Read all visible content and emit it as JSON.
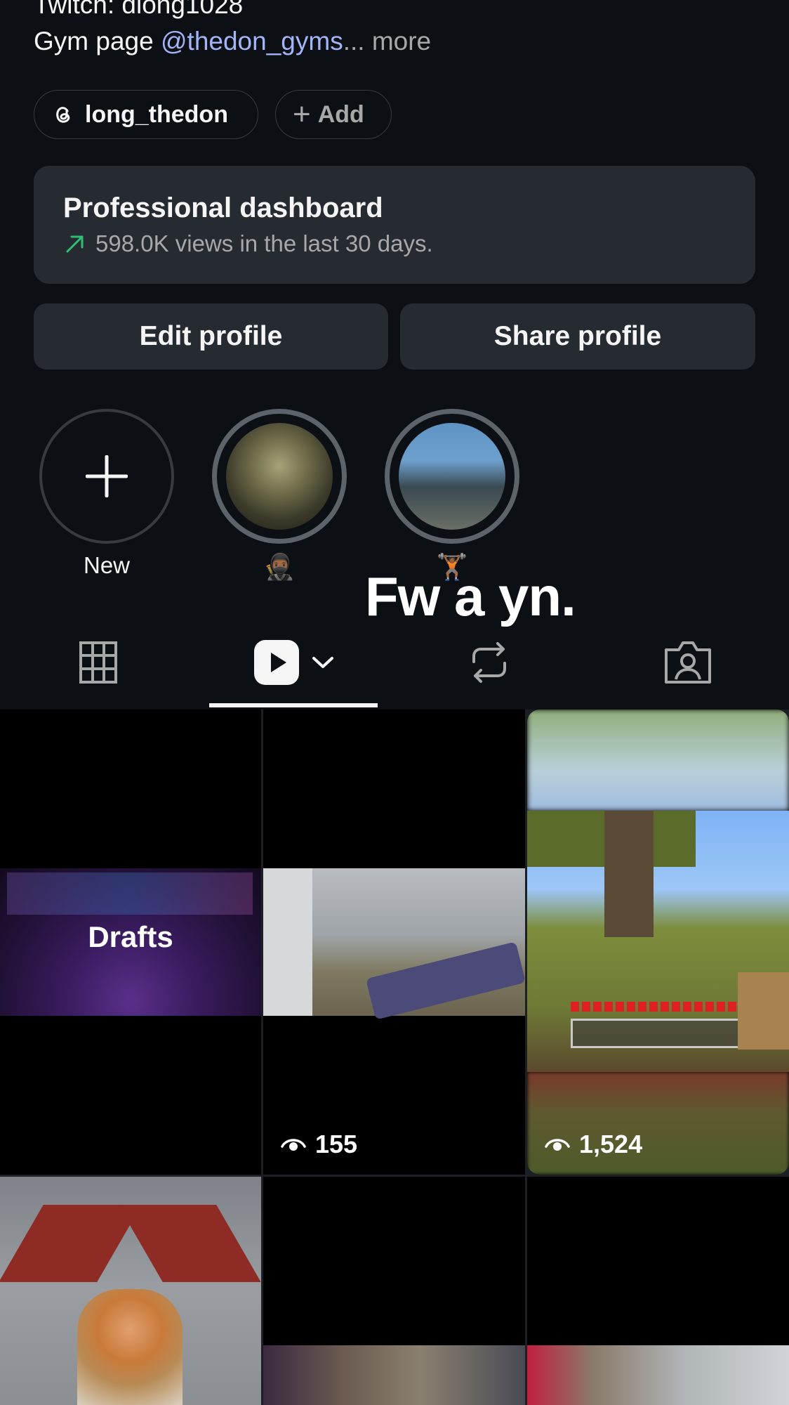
{
  "bio": {
    "twitch_line": "Twitch: dlong1028",
    "gym_prefix": "Gym page ",
    "gym_link": "@thedon_gyms",
    "ellipsis": "...",
    "more": " more"
  },
  "links": {
    "threads_handle": "long_thedon",
    "add_label": "Add"
  },
  "dashboard": {
    "title": "Professional dashboard",
    "subtitle": "598.0K views in the last 30 days.",
    "accent": "#2fbf71"
  },
  "buttons": {
    "edit": "Edit profile",
    "share": "Share profile"
  },
  "highlights": [
    {
      "label": "New",
      "kind": "new"
    },
    {
      "label": "🥷🏾",
      "kind": "image"
    },
    {
      "label": "🏋🏾",
      "kind": "image"
    }
  ],
  "overlay_caption": "Fw a yn.",
  "tabs": {
    "active": "reels",
    "icons": [
      "grid-icon",
      "reels-icon",
      "reposts-icon",
      "tagged-icon"
    ]
  },
  "grid": {
    "drafts_label": "Drafts",
    "item2_views": "155",
    "item3_views": "1,524"
  },
  "colors": {
    "background": "#0c1014",
    "surface": "#262a31",
    "link": "#a3b5f7"
  }
}
